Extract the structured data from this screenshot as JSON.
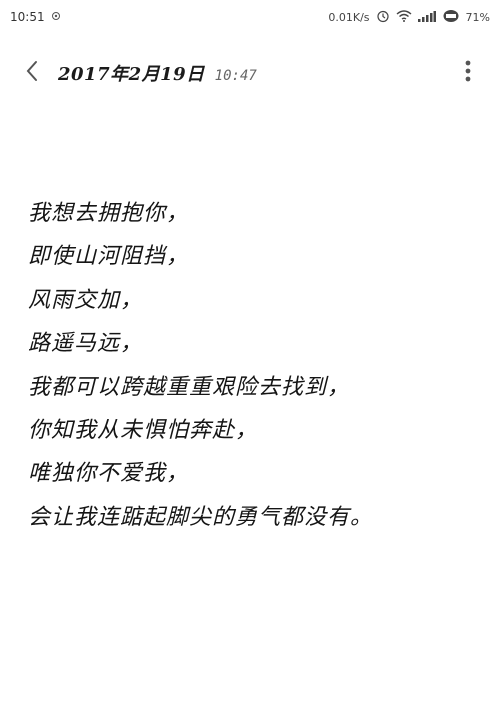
{
  "status_bar": {
    "time": "10:51",
    "speed": "0.01K/s",
    "battery": "71%",
    "icons": [
      "settings-gear-small-icon",
      "alarm-clock-icon",
      "wifi-icon",
      "signal-icon",
      "battery-icon"
    ]
  },
  "toolbar": {
    "date": "2017年2月19日",
    "time": "10:47",
    "icons": [
      "back-chevron-icon",
      "more-vert-icon"
    ]
  },
  "note": {
    "lines": [
      "我想去拥抱你，",
      "即使山河阻挡，",
      "风雨交加，",
      "路遥马远，",
      "我都可以跨越重重艰险去找到，",
      "你知我从未惧怕奔赴，",
      "唯独你不爱我，",
      "会让我连踮起脚尖的勇气都没有。"
    ]
  }
}
